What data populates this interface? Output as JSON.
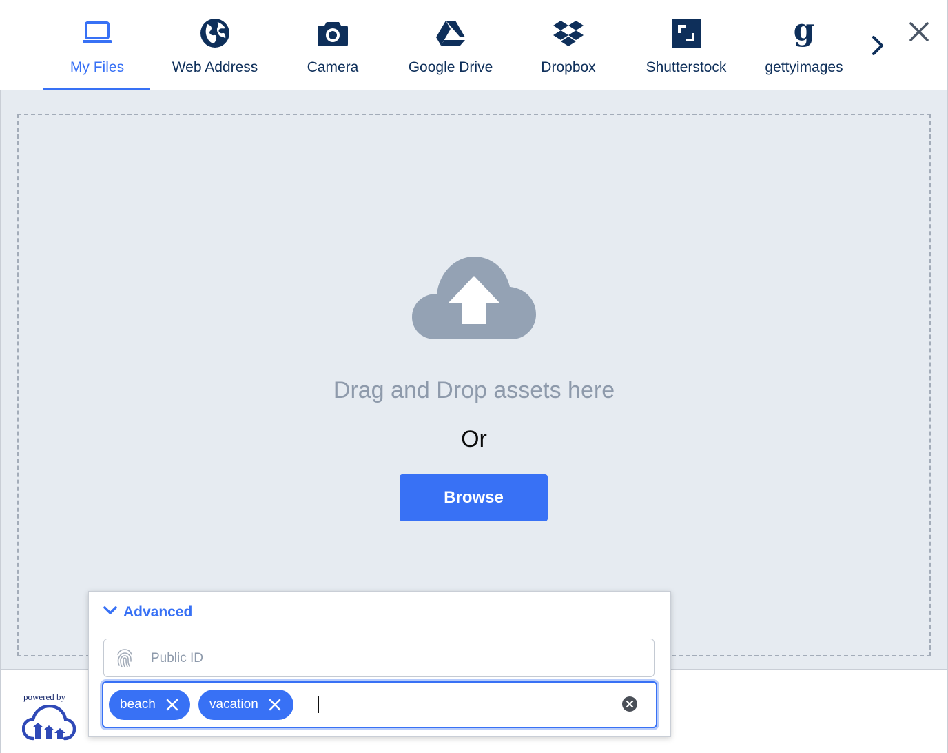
{
  "tabs": [
    {
      "label": "My Files",
      "icon": "laptop-icon",
      "active": true
    },
    {
      "label": "Web Address",
      "icon": "globe-icon"
    },
    {
      "label": "Camera",
      "icon": "camera-icon"
    },
    {
      "label": "Google Drive",
      "icon": "google-drive-icon"
    },
    {
      "label": "Dropbox",
      "icon": "dropbox-icon"
    },
    {
      "label": "Shutterstock",
      "icon": "shutterstock-icon"
    },
    {
      "label": "gettyimages",
      "icon": "gettyimages-icon"
    }
  ],
  "dropzone": {
    "drag_text": "Drag and Drop assets here",
    "or_text": "Or",
    "browse_label": "Browse"
  },
  "advanced": {
    "label": "Advanced",
    "public_id_placeholder": "Public ID",
    "tags": [
      "beach",
      "vacation"
    ]
  },
  "footer": {
    "powered_by": "powered by"
  },
  "colors": {
    "accent": "#3871f5",
    "navy": "#0e2f5a",
    "muted": "#8e9aab",
    "background": "#e6ebf1"
  }
}
